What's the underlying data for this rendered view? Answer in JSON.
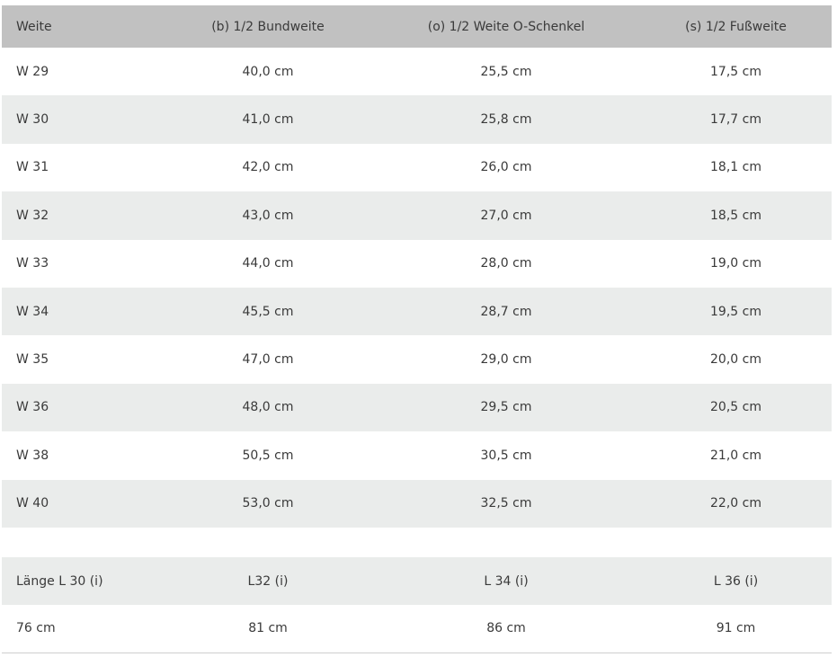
{
  "header": [
    "Weite",
    "(b) 1/2 Bundweite",
    "(o) 1/2 Weite O-Schenkel",
    "(s) 1/2 Fußweite"
  ],
  "rows": [
    [
      "W 29",
      "40,0 cm",
      "25,5 cm",
      "17,5 cm"
    ],
    [
      "W 30",
      "41,0 cm",
      "25,8 cm",
      "17,7 cm"
    ],
    [
      "W 31",
      "42,0 cm",
      "26,0 cm",
      "18,1 cm"
    ],
    [
      "W 32",
      "43,0 cm",
      "27,0 cm",
      "18,5 cm"
    ],
    [
      "W 33",
      "44,0 cm",
      "28,0 cm",
      "19,0 cm"
    ],
    [
      "W 34",
      "45,5 cm",
      "28,7 cm",
      "19,5 cm"
    ],
    [
      "W 35",
      "47,0 cm",
      "29,0 cm",
      "20,0 cm"
    ],
    [
      "W 36",
      "48,0 cm",
      "29,5 cm",
      "20,5 cm"
    ],
    [
      "W 38",
      "50,5 cm",
      "30,5 cm",
      "21,0 cm"
    ],
    [
      "W 40",
      "53,0 cm",
      "32,5 cm",
      "22,0 cm"
    ]
  ],
  "length_header": [
    "Länge L 30 (i)",
    "L32 (i)",
    "L 34 (i)",
    "L 36 (i)"
  ],
  "length_values": [
    "76 cm",
    "81 cm",
    "86 cm",
    "91 cm"
  ],
  "colors": {
    "header_bg": "#c1c1c1",
    "stripe_bg": "#eaeceb",
    "text": "#3a3a3a"
  }
}
